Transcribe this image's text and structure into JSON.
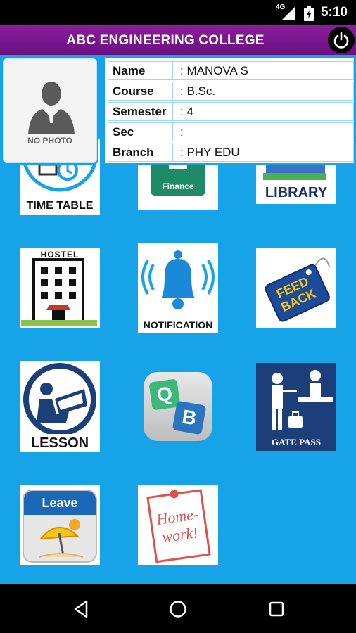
{
  "status_bar": {
    "network": "4G",
    "time": "5:10"
  },
  "header": {
    "title": "ABC ENGINEERING COLLEGE",
    "power_icon": "power-icon"
  },
  "profile": {
    "photo_label": "NO PHOTO",
    "rows": [
      {
        "key": "Name",
        "value": ": MANOVA S"
      },
      {
        "key": "Course",
        "value": ": B.Sc."
      },
      {
        "key": "Semester",
        "value": ": 4"
      },
      {
        "key": "Sec",
        "value": ":"
      },
      {
        "key": "Branch",
        "value": ": PHY EDU"
      }
    ]
  },
  "tiles": {
    "timetable": "TIME TABLE",
    "finance": "Finance",
    "library": "LIBRARY",
    "hostel": "HOSTEL",
    "notification": "NOTIFICATION",
    "feedback_line1": "FEED",
    "feedback_line2": "BACK",
    "lesson": "LESSON",
    "qb_q": "Q",
    "qb_b": "B",
    "gatepass": "GATE PASS",
    "leave": "Leave",
    "homework_line1": "Home-",
    "homework_line2": "work!"
  },
  "colors": {
    "background": "#16a3e8",
    "header": "#7a1590",
    "accent": "#0d4a8a"
  }
}
